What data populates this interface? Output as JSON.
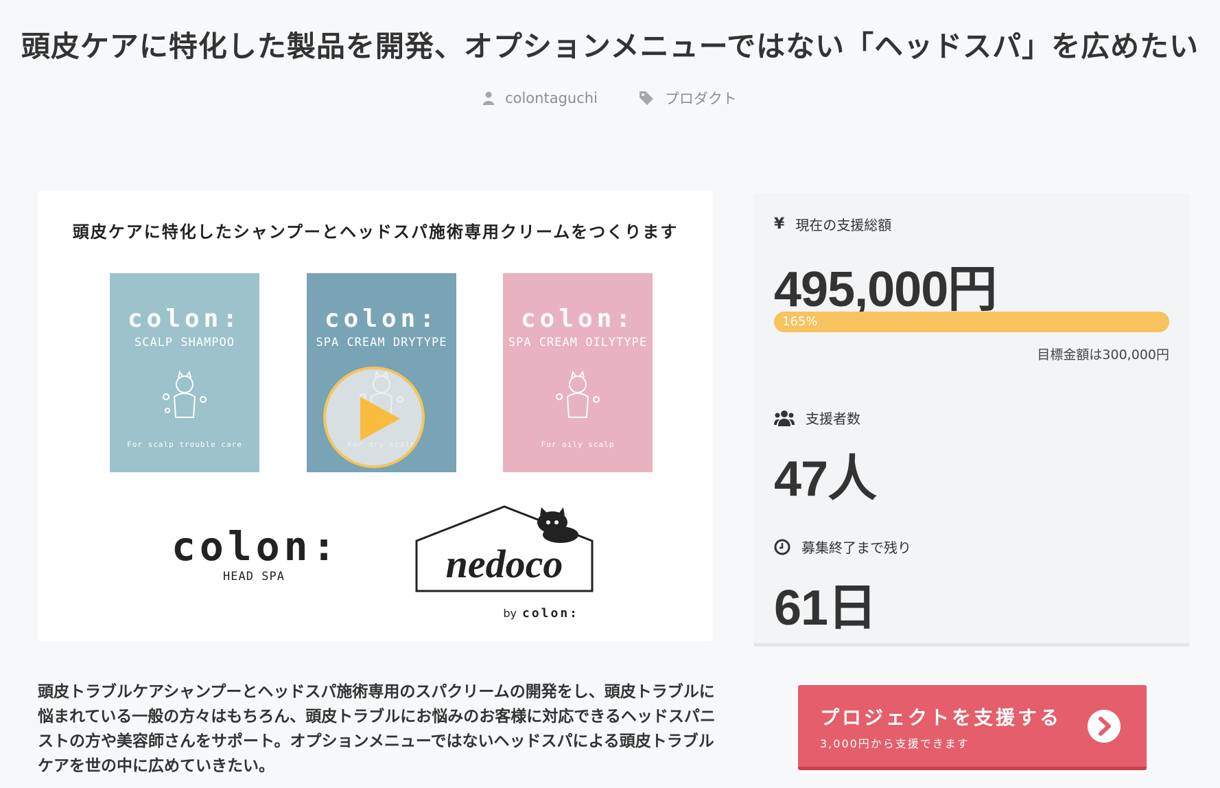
{
  "page": {
    "title": "頭皮ケアに特化した製品を開発、オプションメニューではない「ヘッドスパ」を広めたい",
    "author": "colontaguchi",
    "category": "プロダクト"
  },
  "hero": {
    "caption": "頭皮ケアに特化したシャンプーとヘッドスパ施術専用クリームをつくります",
    "products": [
      {
        "brand": "colon:",
        "name": "SCALP SHAMPOO",
        "tag": "For scalp trouble care",
        "color": "#9cc2cb"
      },
      {
        "brand": "colon:",
        "name": "SPA CREAM DRYTYPE",
        "tag": "For dry scalp",
        "color": "#78a4b6"
      },
      {
        "brand": "colon:",
        "name": "SPA CREAM OILYTYPE",
        "tag": "For oily scalp",
        "color": "#e9b2c0"
      }
    ],
    "logo_colon": {
      "brand": "colon:",
      "sub": "HEAD SPA"
    },
    "logo_nedoco": {
      "brand": "nedoco",
      "by": "by",
      "sub": "colon:"
    }
  },
  "stats": {
    "amount_icon": "yen-icon",
    "amount_label": "現在の支援総額",
    "amount_value": "495,000円",
    "progress_text": "165%",
    "progress_fraction": 1.0,
    "goal_text": "目標金額は300,000円",
    "supporters_label": "支援者数",
    "supporters_value": "47人",
    "remaining_label": "募集終了まで残り",
    "remaining_value": "61日"
  },
  "description": "頭皮トラブルケアシャンプーとヘッドスパ施術専用のスパクリームの開発をし、頭皮トラブルに悩まれている一般の方々はもちろん、頭皮トラブルにお悩みのお客様に対応できるヘッドスパニストの方や美容師さんをサポート。オプションメニューではないヘッドスパによる頭皮トラブルケアを世の中に広めていきたい。",
  "cta": {
    "label": "プロジェクトを支援する",
    "sub": "3,000円から支援できます"
  }
}
